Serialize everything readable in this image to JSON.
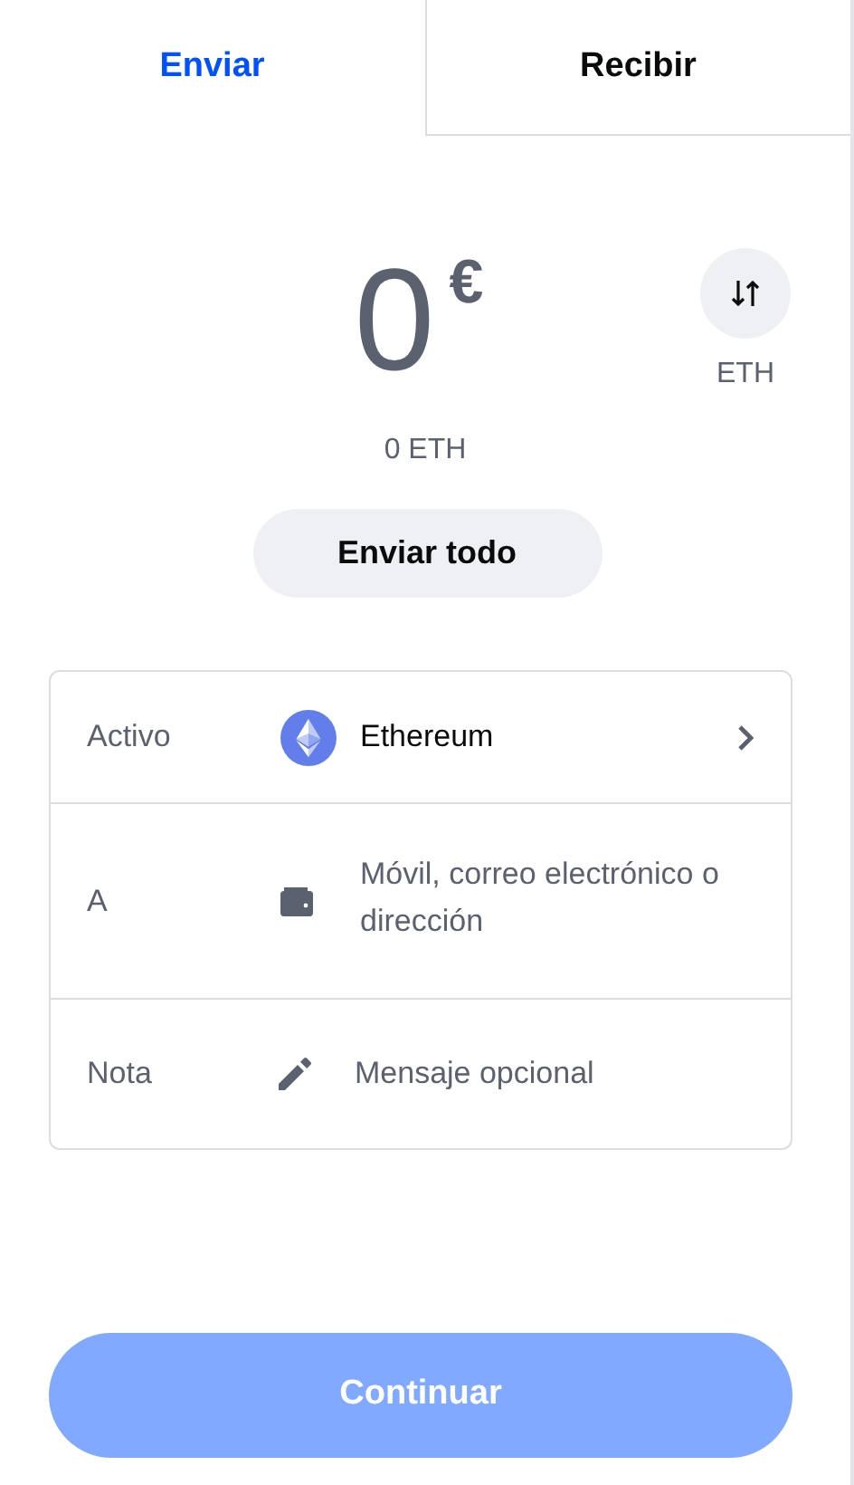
{
  "tabs": [
    {
      "label": "Enviar",
      "selected": true
    },
    {
      "label": "Recibir",
      "selected": false
    }
  ],
  "amount": {
    "value": "0",
    "currency": "€"
  },
  "swap": {
    "label": "ETH"
  },
  "crypto_amount": "0 ETH",
  "send_all_button": "Enviar todo",
  "rows": [
    {
      "kind": "asset",
      "label": "Activo",
      "value": "Ethereum"
    },
    {
      "kind": "recipient",
      "label": "A",
      "placeholder": "Móvil, correo electrónico o dirección"
    },
    {
      "kind": "note",
      "label": "Nota",
      "placeholder": "Mensaje opcional"
    }
  ],
  "continue_button": {
    "label": "Continuar",
    "disabled": true
  }
}
